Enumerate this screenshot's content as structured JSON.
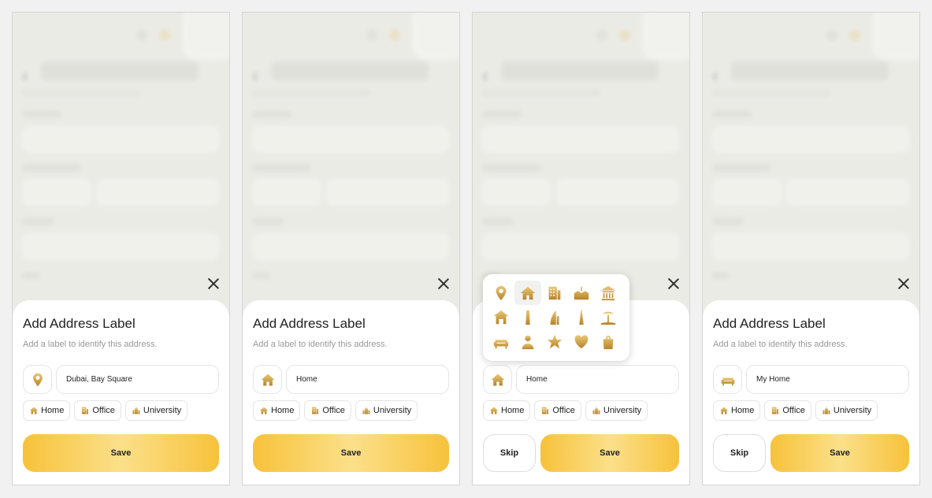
{
  "screens": [
    {
      "title": "Add Address Label",
      "subtitle": "Add a label to identify this address.",
      "selected_icon": "location-pin-icon",
      "input_value": "Dubai, Bay Square",
      "show_skip": false,
      "show_picker": false
    },
    {
      "title": "Add Address Label",
      "subtitle": "Add a label to identify this address.",
      "selected_icon": "house-icon",
      "input_value": "Home",
      "show_skip": false,
      "show_picker": false
    },
    {
      "title": "Add Address Label",
      "subtitle": "Add a label to identify this address.",
      "selected_icon": "house-icon",
      "input_value": "Home",
      "show_skip": true,
      "show_picker": true
    },
    {
      "title": "Add Address Label",
      "subtitle": "Add a label to identify this address.",
      "selected_icon": "sofa-icon",
      "input_value": "My Home",
      "show_skip": true,
      "show_picker": false
    }
  ],
  "chips": [
    {
      "label": "Home",
      "icon": "house-icon"
    },
    {
      "label": "Office",
      "icon": "office-building-icon"
    },
    {
      "label": "University",
      "icon": "university-icon"
    }
  ],
  "buttons": {
    "save": "Save",
    "skip": "Skip"
  },
  "icon_picker": {
    "icons": [
      "location-pin-icon",
      "house-icon",
      "office-building-icon",
      "school-icon",
      "museum-icon",
      "villa-icon",
      "tower-icon",
      "burj-al-arab-icon",
      "burj-khalifa-icon",
      "beach-icon",
      "sofa-icon",
      "person-icon",
      "star-icon",
      "heart-icon",
      "shopping-bag-icon"
    ],
    "selected_index": 1
  },
  "colors": {
    "accent": "#f7c23b",
    "gold": "#c89a34",
    "gold_light": "#e8c370"
  }
}
